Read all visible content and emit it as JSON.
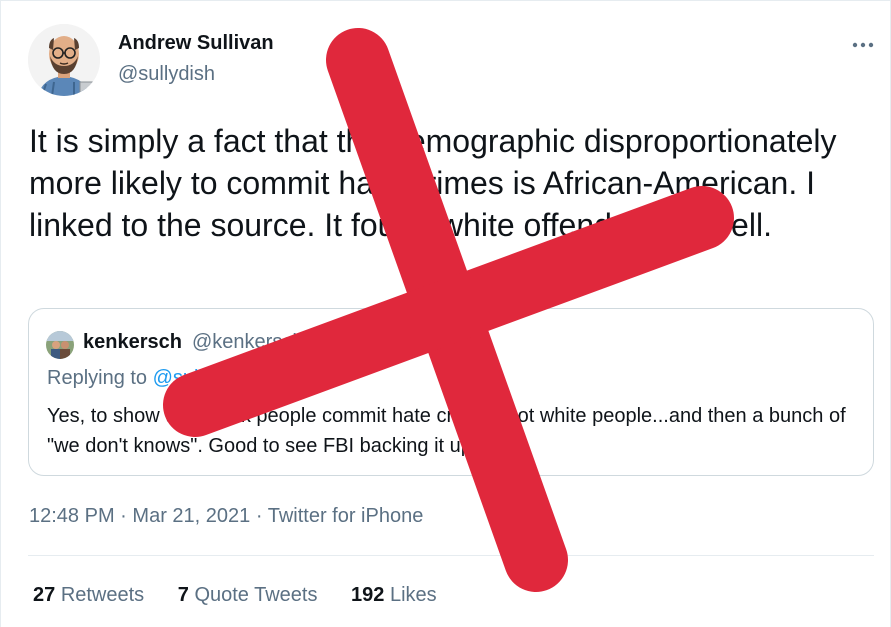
{
  "author": {
    "name": "Andrew Sullivan",
    "handle": "@sullydish"
  },
  "tweet": {
    "text": "It is simply a fact that the demographic disproportionately more likely to commit hate crimes is African-American. I linked to the source. It found white offenders as well."
  },
  "quoted": {
    "name": "kenkersch",
    "handle": "@kenkersch",
    "replying_label": "Replying to",
    "replying_to": "@sullydish",
    "text": "Yes, to show that black people commit hate crimes, not white people...and then a bunch of \"we don't knows\". Good to see FBI backing it up!"
  },
  "meta": {
    "time": "12:48 PM",
    "date": "Mar 21, 2021",
    "separator": "·",
    "source": "Twitter for iPhone"
  },
  "stats": {
    "retweets_count": "27",
    "retweets_label": "Retweets",
    "quote_tweets_count": "7",
    "quote_tweets_label": "Quote Tweets",
    "likes_count": "192",
    "likes_label": "Likes"
  },
  "colors": {
    "overlay_x": "#e0283c",
    "secondary_text": "#5b7083",
    "link": "#1d9bf0"
  },
  "icons": {
    "more": "more-horizontal-icon"
  }
}
